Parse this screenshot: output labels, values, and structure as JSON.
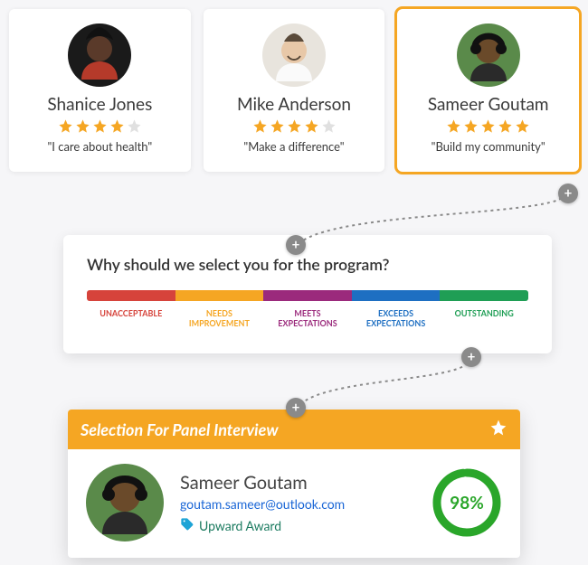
{
  "candidates": [
    {
      "name": "Shanice Jones",
      "stars": 4,
      "quote": "\"I care about health\""
    },
    {
      "name": "Mike Anderson",
      "stars": 4,
      "quote": "\"Make a difference\""
    },
    {
      "name": "Sameer Goutam",
      "stars": 5,
      "quote": "\"Build my community\"",
      "highlighted": true
    }
  ],
  "rating": {
    "question": "Why should we select you for the program?",
    "scale": [
      {
        "label": "UNACCEPTABLE",
        "color": "#d6433b"
      },
      {
        "label": "NEEDS IMPROVEMENT",
        "color": "#f5a623"
      },
      {
        "label": "MEETS EXPECTATIONS",
        "color": "#9b2a7c"
      },
      {
        "label": "EXCEEDS EXPECTATIONS",
        "color": "#1e6fc2"
      },
      {
        "label": "OUTSTANDING",
        "color": "#1f9e55"
      }
    ]
  },
  "panel": {
    "title": "Selection For Panel Interview",
    "name": "Sameer Goutam",
    "email": "goutam.sameer@outlook.com",
    "tag": "Upward Award",
    "score_pct": 98,
    "score_text": "98%"
  },
  "colors": {
    "accent": "#f5a623",
    "ring": "#2aa62a"
  }
}
